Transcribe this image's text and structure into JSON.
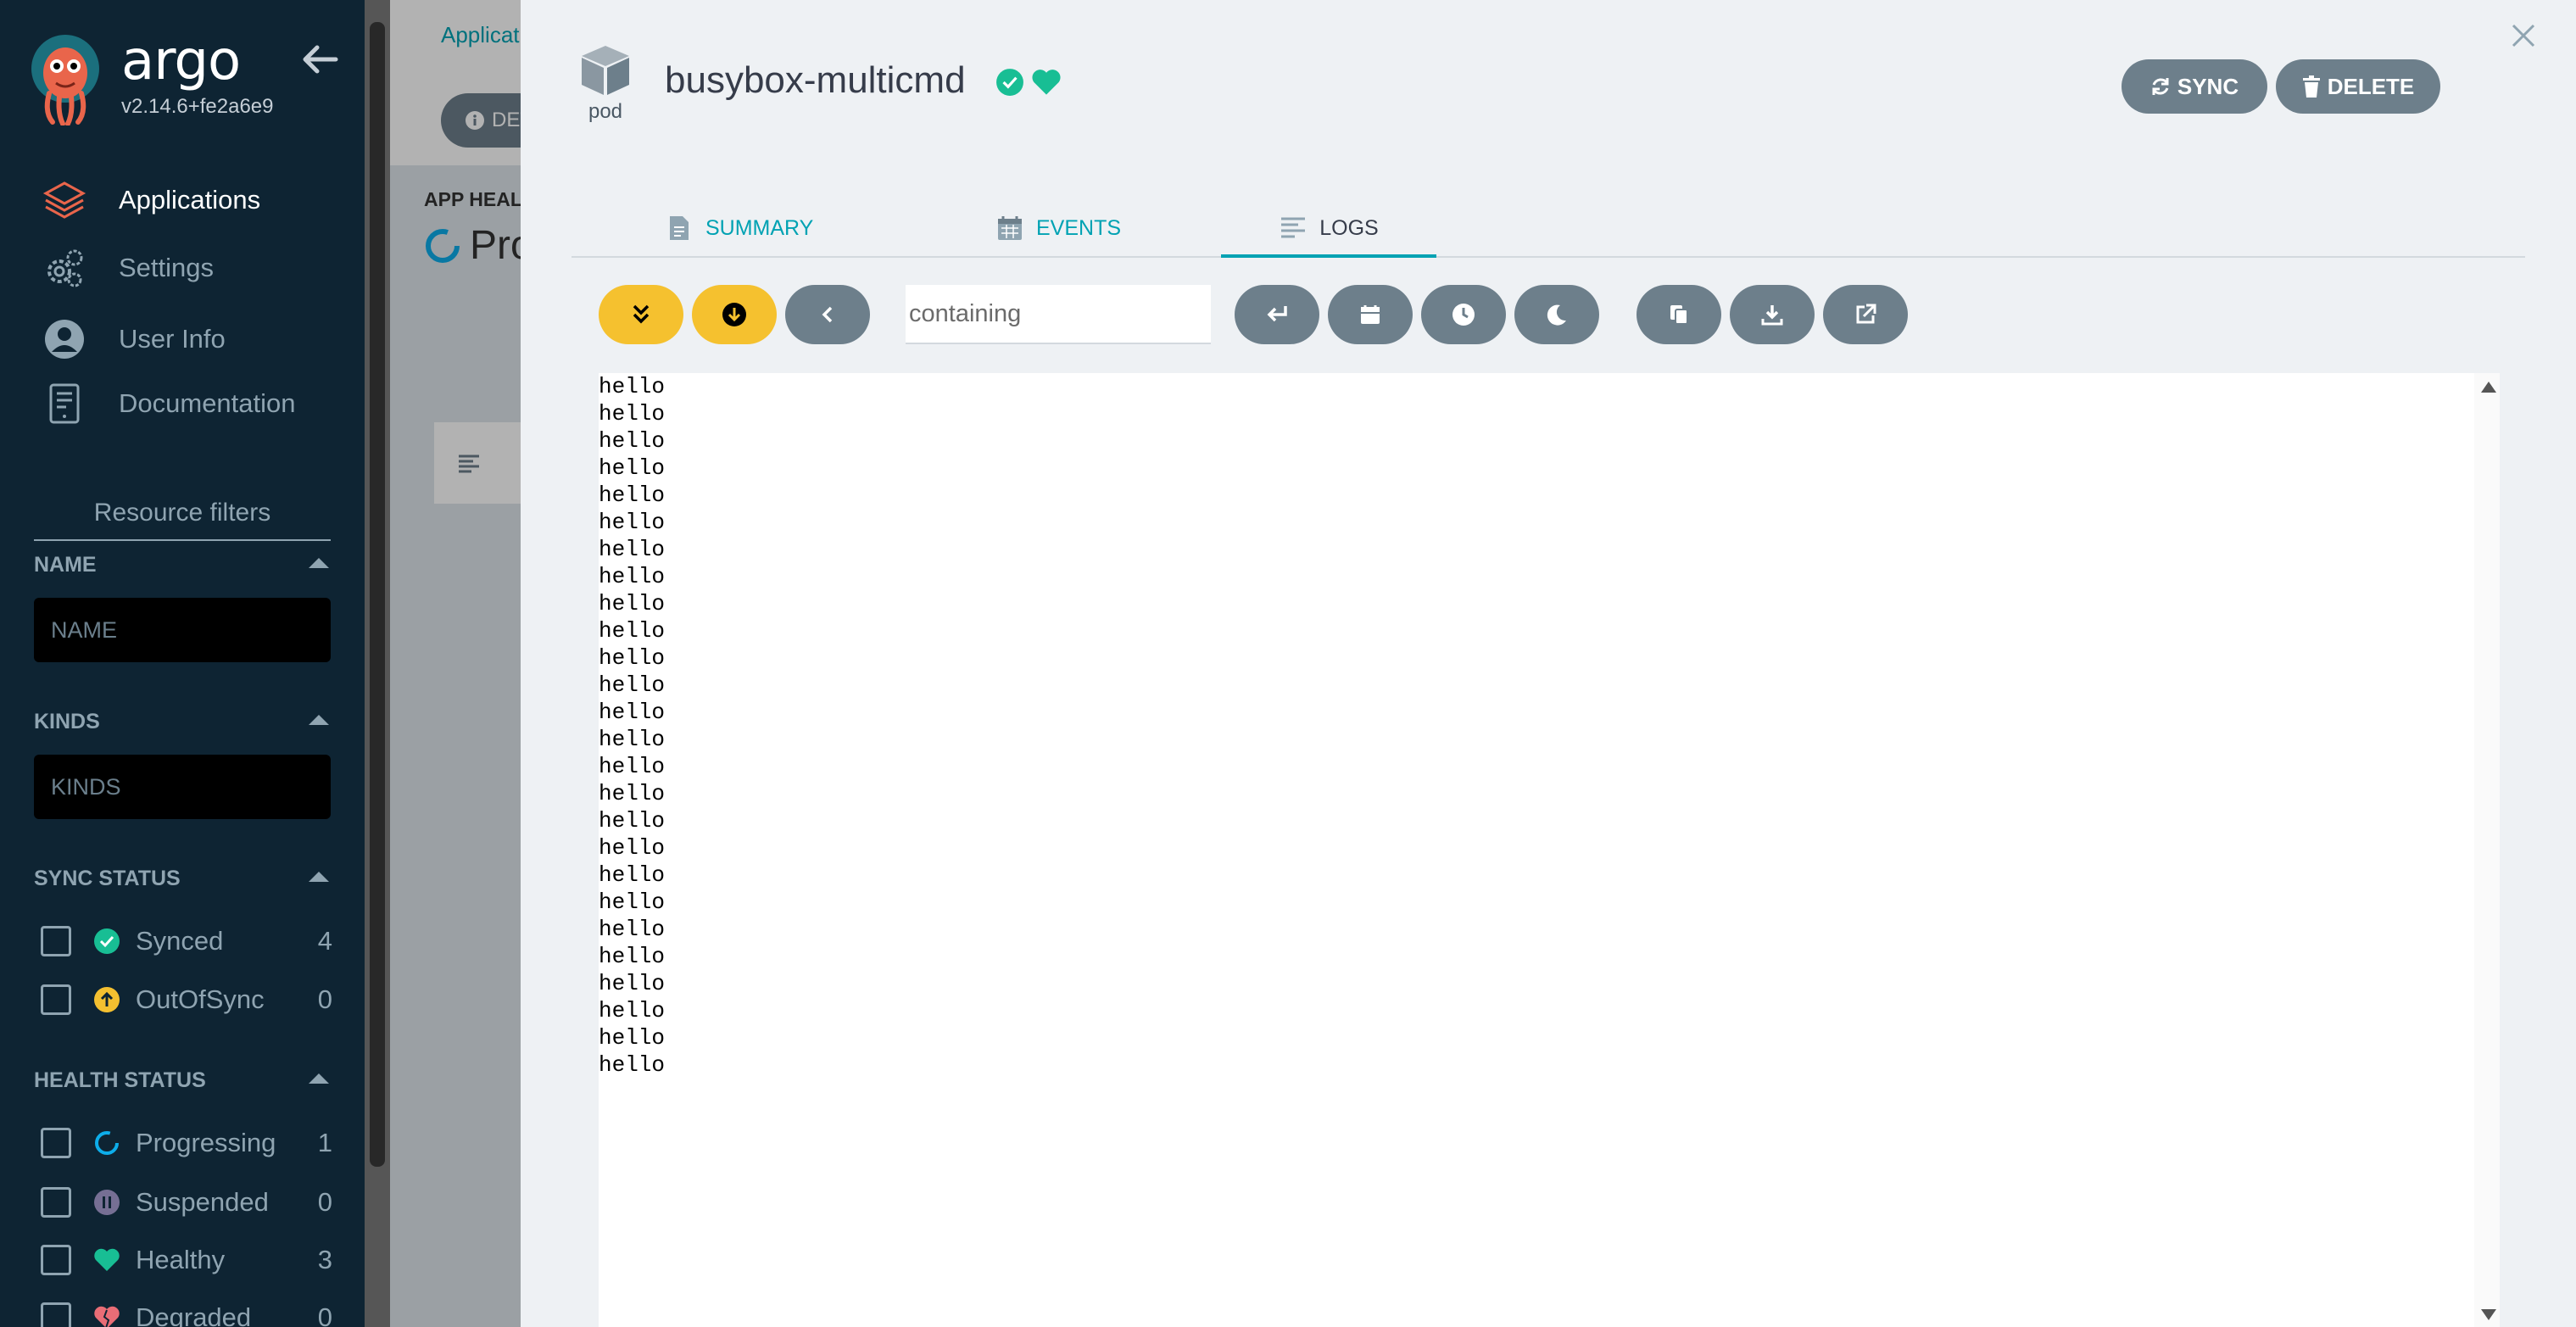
{
  "sidebar": {
    "brand": "argo",
    "version": "v2.14.6+fe2a6e9",
    "nav": [
      {
        "label": "Applications",
        "icon": "layers-icon",
        "active": true
      },
      {
        "label": "Settings",
        "icon": "gears-icon",
        "active": false
      },
      {
        "label": "User Info",
        "icon": "user-circle-icon",
        "active": false
      },
      {
        "label": "Documentation",
        "icon": "book-icon",
        "active": false
      }
    ],
    "filters_title": "Resource filters",
    "name_section": {
      "title": "NAME",
      "placeholder": "NAME"
    },
    "kinds_section": {
      "title": "KINDS",
      "placeholder": "KINDS"
    },
    "sync_status": {
      "title": "SYNC STATUS",
      "items": [
        {
          "label": "Synced",
          "count": "4",
          "icon": "check-circle-icon",
          "color": "#18be94"
        },
        {
          "label": "OutOfSync",
          "count": "0",
          "icon": "arrow-circle-up-icon",
          "color": "#f4c030"
        }
      ]
    },
    "health_status": {
      "title": "HEALTH STATUS",
      "items": [
        {
          "label": "Progressing",
          "count": "1",
          "icon": "progress-ring-icon",
          "color": "#0dadea"
        },
        {
          "label": "Suspended",
          "count": "0",
          "icon": "pause-circle-icon",
          "color": "#766f94"
        },
        {
          "label": "Healthy",
          "count": "3",
          "icon": "heart-icon",
          "color": "#18be94"
        },
        {
          "label": "Degraded",
          "count": "0",
          "icon": "broken-heart-icon",
          "color": "#e96d76"
        }
      ]
    }
  },
  "background": {
    "breadcrumb": "Application",
    "details_button": "DETA",
    "app_health_label": "APP HEALT",
    "app_health_value": "Pro"
  },
  "panel": {
    "kind": "pod",
    "title": "busybox-multicmd",
    "sync_button": "SYNC",
    "delete_button": "DELETE",
    "tabs": [
      {
        "label": "SUMMARY",
        "icon": "file-icon"
      },
      {
        "label": "EVENTS",
        "icon": "calendar-icon"
      },
      {
        "label": "LOGS",
        "icon": "lines-icon"
      }
    ],
    "active_tab": "LOGS",
    "log_filter_placeholder": "containing",
    "log_lines": [
      "hello",
      "hello",
      "hello",
      "hello",
      "hello",
      "hello",
      "hello",
      "hello",
      "hello",
      "hello",
      "hello",
      "hello",
      "hello",
      "hello",
      "hello",
      "hello",
      "hello",
      "hello",
      "hello",
      "hello",
      "hello",
      "hello",
      "hello",
      "hello",
      "hello",
      "hello"
    ]
  },
  "colors": {
    "sidebar_bg": "#0e2433",
    "accent_teal": "#00a2b3",
    "button_gray": "#6d7f8b",
    "button_yellow": "#f5c12f",
    "status_green": "#18be94"
  }
}
